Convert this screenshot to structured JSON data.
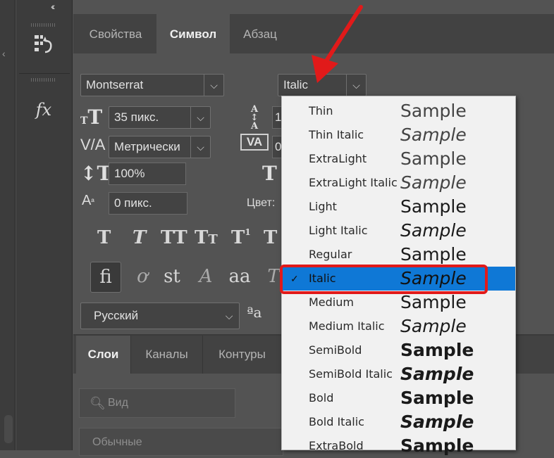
{
  "top_tabs": [
    "Свойства",
    "Символ",
    "Абзац"
  ],
  "font_family": "Montserrat",
  "font_style": "Italic",
  "font_size": "35 пикс.",
  "leading_value": "1",
  "kerning": "Метрически",
  "tracking_value": "0",
  "vertical_scale": "100%",
  "baseline_shift": "0 пикс.",
  "color_label": "Цвет:",
  "language": "Русский",
  "aa_label": "a a",
  "layers_tabs": [
    "Слои",
    "Каналы",
    "Контуры"
  ],
  "filter_placeholder": "Вид",
  "blend_mode": "Обычные",
  "popup_items": [
    {
      "name": "Thin",
      "sample": "Sample"
    },
    {
      "name": "Thin Italic",
      "sample": "Sample"
    },
    {
      "name": "ExtraLight",
      "sample": "Sample"
    },
    {
      "name": "ExtraLight Italic",
      "sample": "Sample"
    },
    {
      "name": "Light",
      "sample": "Sample"
    },
    {
      "name": "Light Italic",
      "sample": "Sample"
    },
    {
      "name": "Regular",
      "sample": "Sample"
    },
    {
      "name": "Italic",
      "sample": "Sample",
      "selected": true
    },
    {
      "name": "Medium",
      "sample": "Sample"
    },
    {
      "name": "Medium Italic",
      "sample": "Sample"
    },
    {
      "name": "SemiBold",
      "sample": "Sample"
    },
    {
      "name": "SemiBold Italic",
      "sample": "Sample"
    },
    {
      "name": "Bold",
      "sample": "Sample"
    },
    {
      "name": "Bold Italic",
      "sample": "Sample"
    },
    {
      "name": "ExtraBold",
      "sample": "Sample"
    }
  ],
  "colors": {
    "accent": "#0f78d6",
    "annotation": "#e11a1a",
    "panel": "#535353"
  }
}
